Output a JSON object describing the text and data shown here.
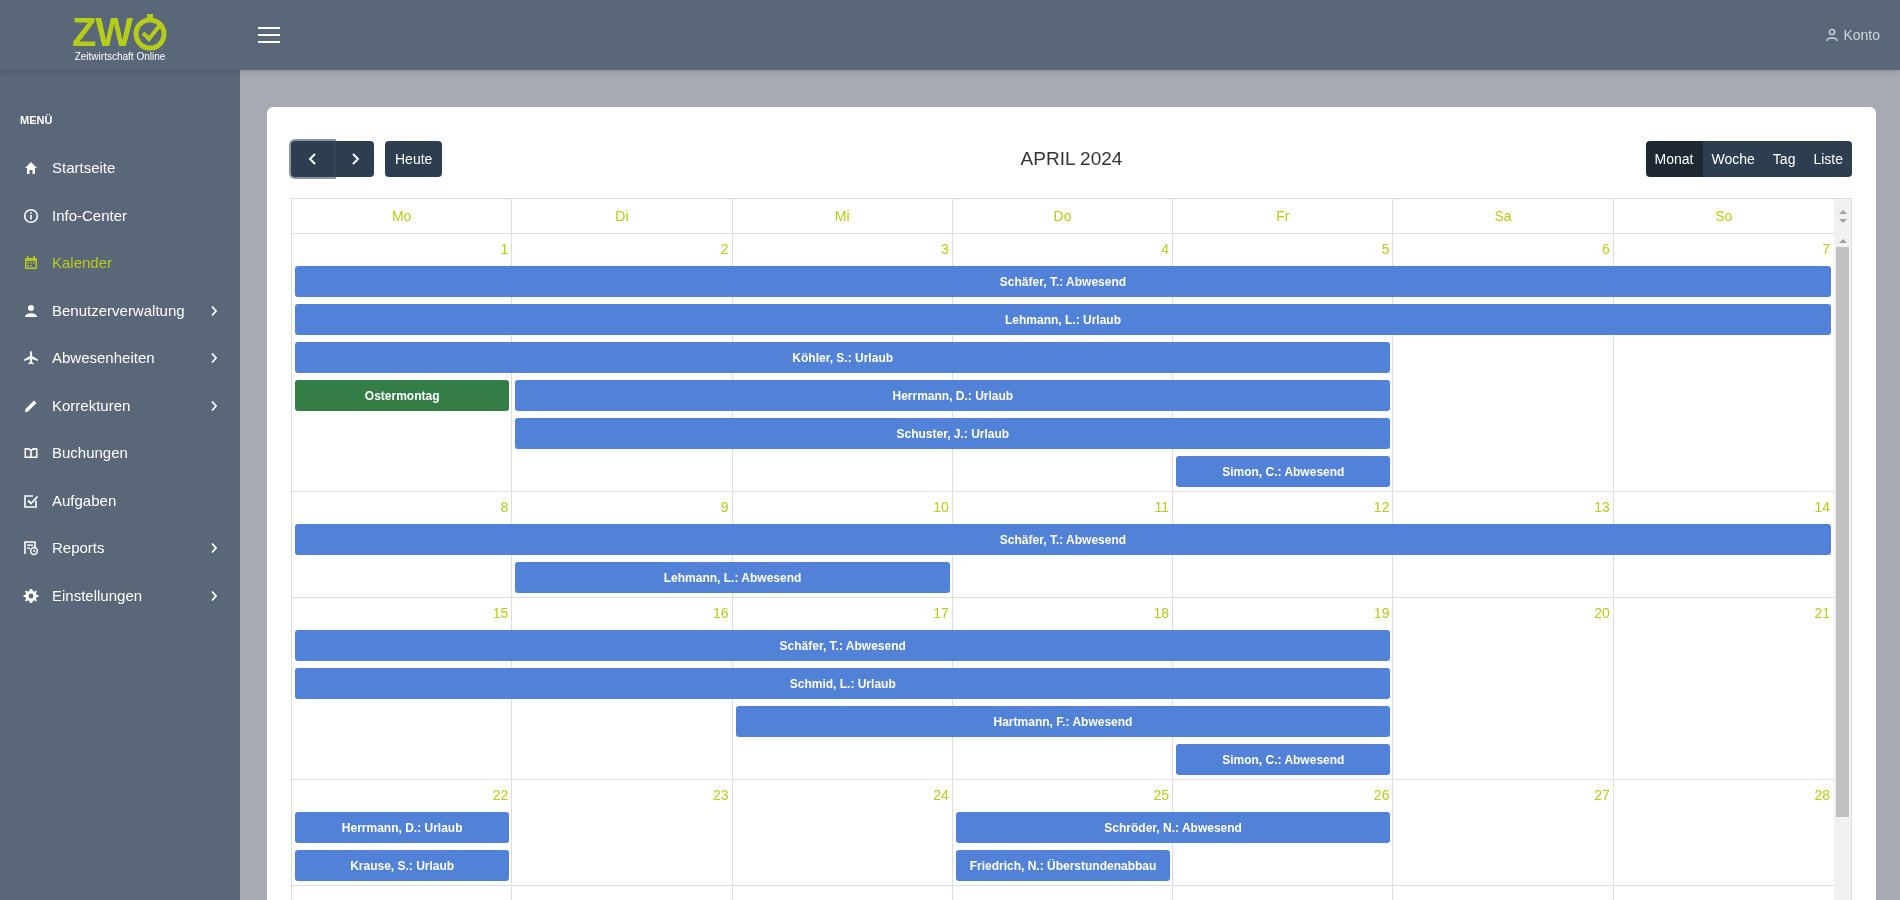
{
  "logo": {
    "text": "ZW",
    "subtitle": "Zeitwirtschaft Online"
  },
  "account": {
    "label": "Konto"
  },
  "sidebar": {
    "heading": "MENÜ",
    "items": [
      {
        "label": "Startseite",
        "kind": "link",
        "selected": false
      },
      {
        "label": "Info-Center",
        "kind": "link",
        "selected": false
      },
      {
        "label": "Kalender",
        "kind": "link",
        "selected": true
      },
      {
        "label": "Benutzerverwaltung",
        "kind": "group",
        "selected": false
      },
      {
        "label": "Abwesenheiten",
        "kind": "group",
        "selected": false
      },
      {
        "label": "Korrekturen",
        "kind": "group",
        "selected": false
      },
      {
        "label": "Buchungen",
        "kind": "link",
        "selected": false
      },
      {
        "label": "Aufgaben",
        "kind": "link",
        "selected": false
      },
      {
        "label": "Reports",
        "kind": "group",
        "selected": false
      },
      {
        "label": "Einstellungen",
        "kind": "group",
        "selected": false
      }
    ]
  },
  "toolbar": {
    "today": "Heute",
    "title": "APRIL 2024",
    "views": [
      {
        "label": "Monat",
        "selected": true
      },
      {
        "label": "Woche",
        "selected": false
      },
      {
        "label": "Tag",
        "selected": false
      },
      {
        "label": "Liste",
        "selected": false
      }
    ]
  },
  "weekdays": [
    "Mo",
    "Di",
    "Mi",
    "Do",
    "Fr",
    "Sa",
    "So"
  ],
  "weeks": [
    {
      "days": [
        "1",
        "2",
        "3",
        "4",
        "5",
        "6",
        "7"
      ],
      "events": [
        {
          "label": "Schäfer, T.: Abwesend",
          "color": "#5282d8"
        },
        {
          "label": "Lehmann, L.: Urlaub",
          "color": "#5282d8"
        },
        {
          "label": "Köhler, S.: Urlaub",
          "color": "#5282d8"
        },
        {
          "label": "Ostermontag",
          "color": "#347d47"
        },
        {
          "label": "Herrmann, D.: Urlaub",
          "color": "#5282d8"
        },
        {
          "label": "Schuster, J.: Urlaub",
          "color": "#5282d8"
        },
        {
          "label": "Simon, C.: Abwesend",
          "color": "#5282d8"
        }
      ]
    },
    {
      "days": [
        "8",
        "9",
        "10",
        "11",
        "12",
        "13",
        "14"
      ],
      "events": [
        {
          "label": "Schäfer, T.: Abwesend",
          "color": "#5282d8"
        },
        {
          "label": "Lehmann, L.: Abwesend",
          "color": "#5282d8"
        }
      ]
    },
    {
      "days": [
        "15",
        "16",
        "17",
        "18",
        "19",
        "20",
        "21"
      ],
      "events": [
        {
          "label": "Schäfer, T.: Abwesend",
          "color": "#5282d8"
        },
        {
          "label": "Schmid, L.: Urlaub",
          "color": "#5282d8"
        },
        {
          "label": "Hartmann, F.: Abwesend",
          "color": "#5282d8"
        },
        {
          "label": "Simon, C.: Abwesend",
          "color": "#5282d8"
        }
      ]
    },
    {
      "days": [
        "22",
        "23",
        "24",
        "25",
        "26",
        "27",
        "28"
      ],
      "events": [
        {
          "label": "Herrmann, D.: Urlaub",
          "color": "#5282d8"
        },
        {
          "label": "Schröder, N.: Abwesend",
          "color": "#5282d8"
        },
        {
          "label": "Krause, S.: Urlaub",
          "color": "#5282d8"
        },
        {
          "label": "Friedrich, N.: Überstundenabbau",
          "color": "#5282d8"
        }
      ]
    }
  ]
}
